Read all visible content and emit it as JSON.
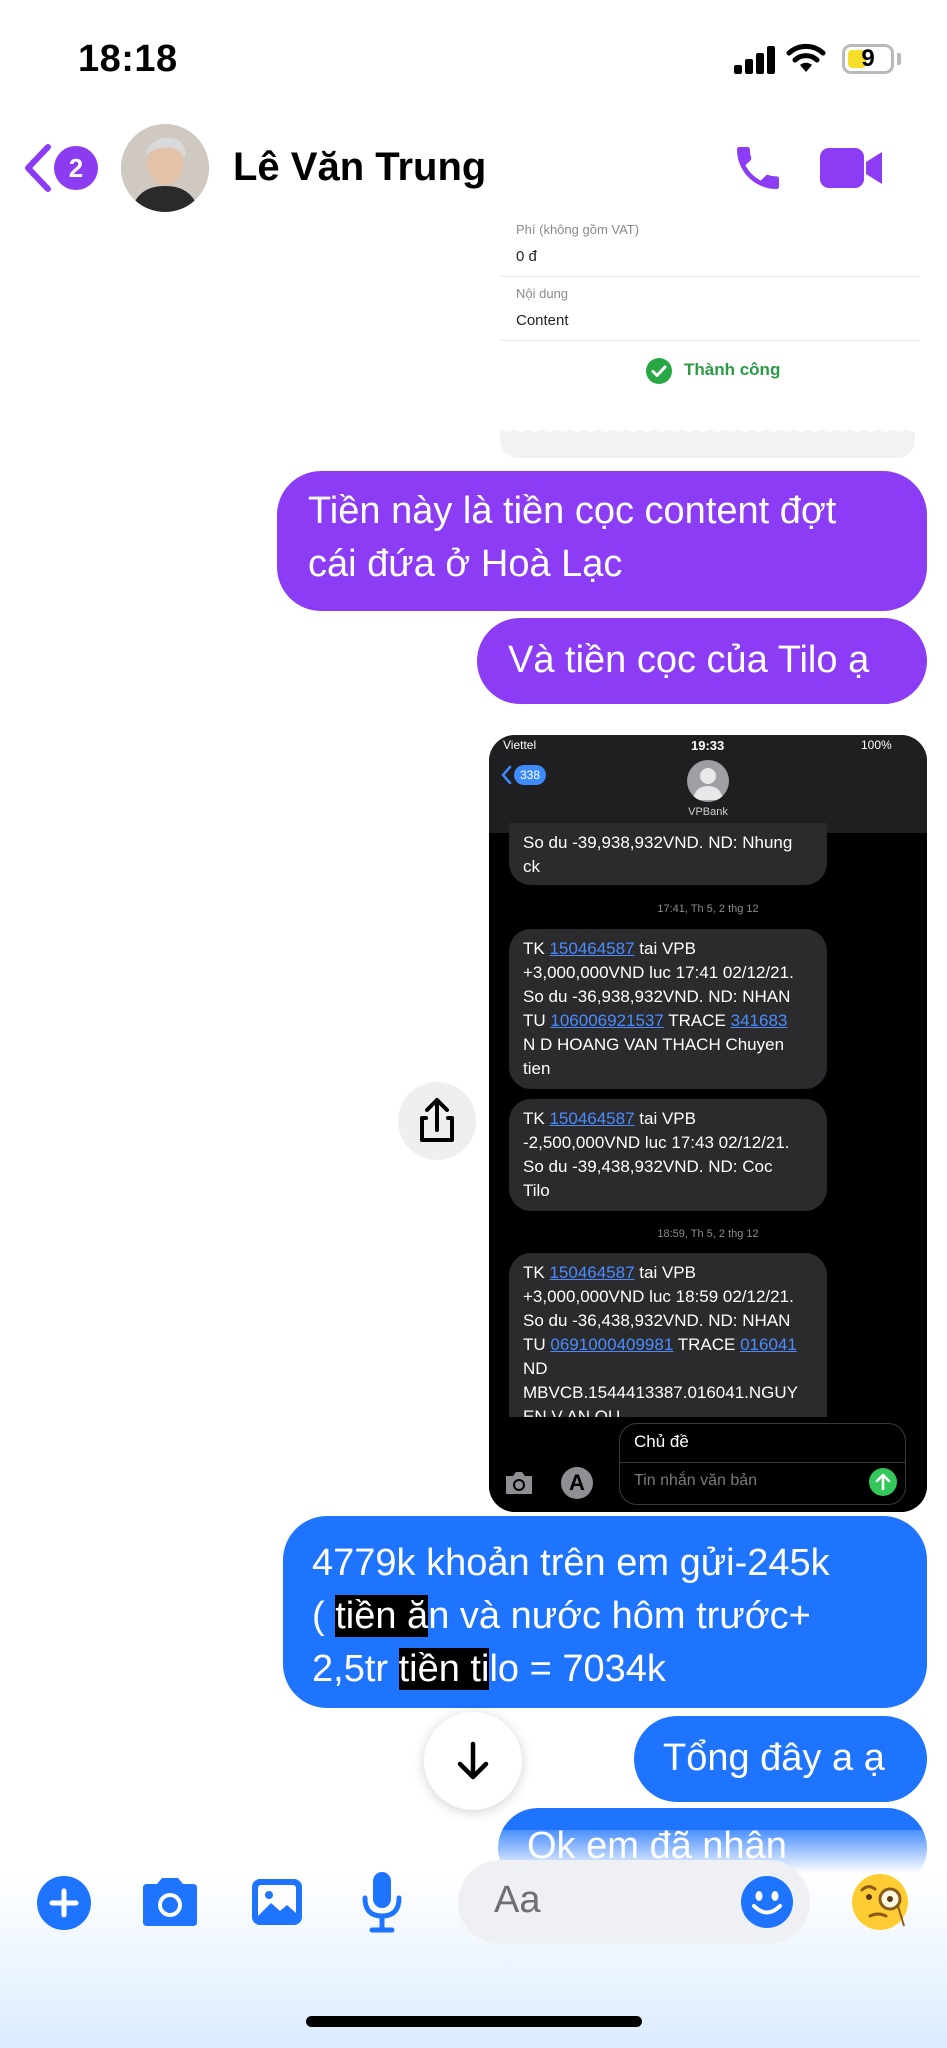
{
  "status_bar": {
    "time": "18:18",
    "battery": "9"
  },
  "header": {
    "back_count": "2",
    "contact_name": "Lê Văn Trung"
  },
  "receipt": {
    "fee_label": "Phí (không gồm VAT)",
    "fee_value": "0 đ",
    "content_label": "Nội dung",
    "content_value": "Content",
    "status": "Thành công"
  },
  "messages": {
    "m1_line1": "Tiền này là tiền cọc content đợt",
    "m1_line2": "cái đứa ở Hoà Lạc",
    "m2": "Và tiền cọc của Tilo ạ",
    "m3_line1": "4779k khoản trên em gửi-245k",
    "m3_l2_a": "( ",
    "m3_l2_hl1": "tiền ă",
    "m3_l2_b": "n và nước hôm trước+",
    "m3_l3_a": "2,5tr ",
    "m3_l3_hl": "tiền ti",
    "m3_l3_b": "lo = 7034k",
    "m4": "Tổng đây a ạ",
    "m5_partial": "Ok em đã nhận"
  },
  "screenshot": {
    "carrier": "Viettel",
    "time": "19:33",
    "battery": "100%",
    "back_count": "338",
    "sender": "VPBank",
    "sms0_line1": "So du -39,938,932VND. ND: Nhung",
    "sms0_line2": "ck",
    "ts1": "17:41, Th 5, 2 thg 12",
    "sms1": {
      "p1": "TK ",
      "acct": "150464587",
      "p2": " tai VPB",
      "l2": "+3,000,000VND luc 17:41 02/12/21.",
      "l3": "So du -36,938,932VND. ND: NHAN",
      "l4a": "TU ",
      "ref1": "106006921537",
      "l4b": " TRACE ",
      "ref2": "341683",
      "l5": "N D HOANG VAN THACH Chuyen",
      "l6": "tien"
    },
    "sms2": {
      "p1": "TK ",
      "acct": "150464587",
      "p2": " tai VPB",
      "l2": "-2,500,000VND luc 17:43 02/12/21.",
      "l3": "So du -39,438,932VND. ND: Coc",
      "l4": "Tilo"
    },
    "ts2": "18:59, Th 5, 2 thg 12",
    "sms3": {
      "p1": "TK ",
      "acct": "150464587",
      "p2": " tai VPB",
      "l2": "+3,000,000VND luc 18:59 02/12/21.",
      "l3": "So du -36,438,932VND. ND: NHAN",
      "l4a": "TU ",
      "ref1": "0691000409981",
      "l4b": " TRACE ",
      "ref2": "016041",
      "l5": "ND",
      "l6": "MBVCB.1544413387.016041.NGUY",
      "l7": "EN V AN QU"
    },
    "subject_label": "Chủ đề",
    "text_placeholder": "Tin nhắn văn bản"
  },
  "composer": {
    "placeholder": "Aa"
  },
  "icons": {
    "back": "chevron-left-icon",
    "call": "phone-icon",
    "video": "video-camera-icon",
    "share": "share-icon",
    "scroll_down": "arrow-down-icon",
    "add": "plus-icon",
    "camera": "camera-icon",
    "gallery": "image-icon",
    "mic": "microphone-icon",
    "emoji": "smiley-icon",
    "reaction": "monocle-face-icon"
  },
  "colors": {
    "accent_purple": "#8b3cf4",
    "messenger_blue": "#1e74ff",
    "success_green": "#2b9a45"
  }
}
